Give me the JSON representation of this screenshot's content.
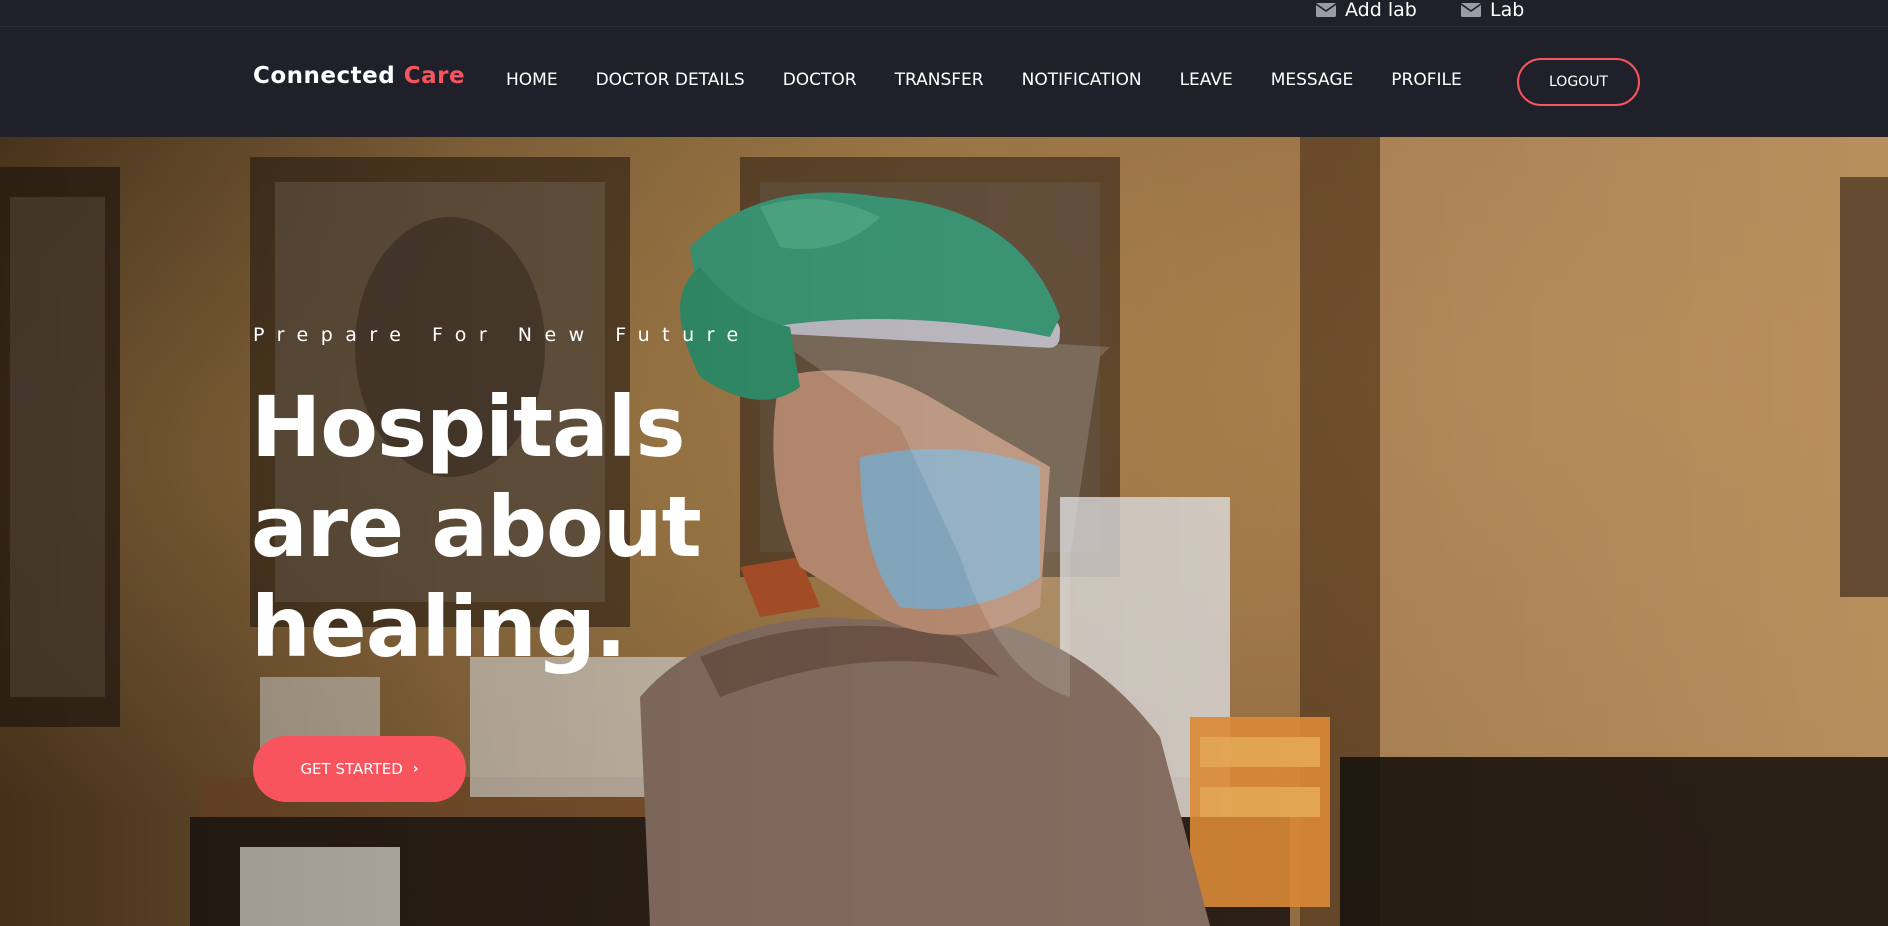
{
  "topbar": {
    "links": [
      {
        "label": "Add lab",
        "icon": "envelope-icon"
      },
      {
        "label": "Lab",
        "icon": "envelope-icon"
      }
    ]
  },
  "navbar": {
    "brand_main": "Connected",
    "brand_accent": "Care",
    "items": [
      {
        "label": "HOME"
      },
      {
        "label": "DOCTOR DETAILS"
      },
      {
        "label": "DOCTOR"
      },
      {
        "label": "TRANSFER"
      },
      {
        "label": "NOTIFICATION"
      },
      {
        "label": "LEAVE"
      },
      {
        "label": "MESSAGE"
      },
      {
        "label": "PROFILE"
      }
    ],
    "logout_label": "LOGOUT"
  },
  "hero": {
    "subtitle": "Prepare For New Future",
    "title_lines": [
      "Hospitals",
      "are about",
      "healing."
    ],
    "cta_label": "GET STARTED",
    "cta_icon": "chevron-right-icon"
  },
  "colors": {
    "accent": "#f7545d",
    "header_bg": "#1f2029",
    "text": "#ffffff"
  }
}
